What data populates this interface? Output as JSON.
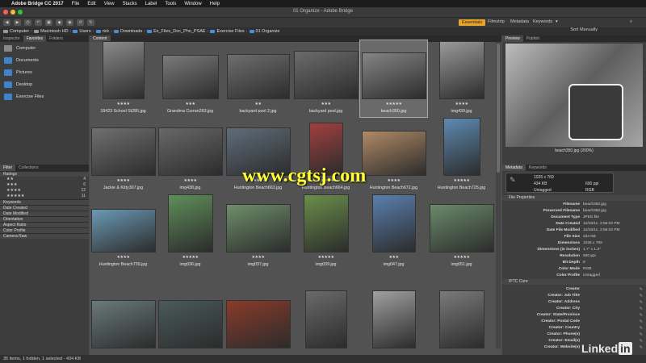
{
  "menubar": {
    "apple": "",
    "app": "Adobe Bridge CC 2017",
    "items": [
      "File",
      "Edit",
      "View",
      "Stacks",
      "Label",
      "Tools",
      "Window",
      "Help"
    ]
  },
  "window": {
    "title": "01 Organize - Adobe Bridge"
  },
  "workspaces": [
    "Essentials",
    "Filmstrip",
    "Metadata",
    "Keywords"
  ],
  "pathbar": {
    "crumbs": [
      "Computer",
      "Macintosh HD",
      "Users",
      "rick",
      "Downloads",
      "Ex_Files_Doc_Pho_PSAE",
      "Exercise Files",
      "01 Organize"
    ],
    "sort": "Sort Manually"
  },
  "leftpanel": {
    "tabs": [
      "Inspector",
      "Favorites",
      "Folders"
    ],
    "favorites": [
      {
        "label": "Computer",
        "icon": "computer-icon"
      },
      {
        "label": "Documents",
        "icon": "folder-icon"
      },
      {
        "label": "Pictures",
        "icon": "folder-icon"
      },
      {
        "label": "Desktop",
        "icon": "folder-icon"
      },
      {
        "label": "Exercise Files",
        "icon": "folder-icon"
      }
    ],
    "filter_tabs": [
      "Filter",
      "Collections"
    ],
    "ratings_header": "Ratings",
    "ratings": [
      {
        "stars": "★★",
        "count": "4"
      },
      {
        "stars": "★★★",
        "count": "6"
      },
      {
        "stars": "★★★★",
        "count": "12"
      },
      {
        "stars": "★★★★★",
        "count": "11"
      }
    ],
    "filter_sections": [
      "Keywords",
      "Date Created",
      "Date Modified",
      "Orientation",
      "Aspect Ratio",
      "Color Profile",
      "Camera Raw"
    ]
  },
  "content": {
    "tab": "Content",
    "thumbs": [
      {
        "name": "18423 School St285.jpg",
        "stars": "★★★★"
      },
      {
        "name": "Grandma Curran283.jpg",
        "stars": "★★★"
      },
      {
        "name": "backyard pool 2.jpg",
        "stars": "★★"
      },
      {
        "name": "backyard pool.jpg",
        "stars": "★★★"
      },
      {
        "name": "beach350.jpg",
        "stars": "★★★★★"
      },
      {
        "name": "img439.jpg",
        "stars": "★★★★"
      },
      {
        "name": "Jackie & Kitty307.jpg",
        "stars": "★★★★"
      },
      {
        "name": "img438.jpg",
        "stars": "★★★★"
      },
      {
        "name": "Huntington Beach663.jpg",
        "stars": "★★★★★"
      },
      {
        "name": "Huntington Beach664.jpg",
        "stars": "★★★★★"
      },
      {
        "name": "Huntington Beach672.jpg",
        "stars": "★★★★"
      },
      {
        "name": "Huntington Beach725.jpg",
        "stars": "★★★★★"
      },
      {
        "name": "Huntington Beach739.jpg",
        "stars": "★★★★"
      },
      {
        "name": "img036.jpg",
        "stars": "★★★★★"
      },
      {
        "name": "img037.jpg",
        "stars": "★★★★"
      },
      {
        "name": "img039.jpg",
        "stars": "★★★★★"
      },
      {
        "name": "img047.jpg",
        "stars": "★★★"
      },
      {
        "name": "img051.jpg",
        "stars": "★★★★★"
      },
      {
        "name": "",
        "stars": ""
      },
      {
        "name": "",
        "stars": ""
      },
      {
        "name": "",
        "stars": ""
      },
      {
        "name": "",
        "stars": ""
      },
      {
        "name": "",
        "stars": ""
      },
      {
        "name": "",
        "stars": ""
      }
    ]
  },
  "watermark": "www.cgtsj.com",
  "rightpanel": {
    "tabs": [
      "Preview",
      "Publish"
    ],
    "preview_caption": "beach350.jpg (200%)",
    "meta_tabs": [
      "Metadata",
      "Keywords"
    ],
    "quick": {
      "dims": "1026 x 769",
      "ppi": "600 ppi",
      "size": "434 KB",
      "mode": "RGB",
      "profile": "Untagged"
    },
    "file_props_header": "File Properties",
    "file_props": [
      {
        "k": "Filename",
        "v": "beach350.jpg"
      },
      {
        "k": "Preserved Filename",
        "v": "beach350.jpg"
      },
      {
        "k": "Document Type",
        "v": "JPEG file"
      },
      {
        "k": "Date Created",
        "v": "12/16/11, 2:56:02 PM"
      },
      {
        "k": "Date File Modified",
        "v": "12/16/11, 2:56:02 PM"
      },
      {
        "k": "File Size",
        "v": "434 KB"
      },
      {
        "k": "Dimensions",
        "v": "1026 x 769"
      },
      {
        "k": "Dimensions (in inches)",
        "v": "1.7\" x 1.3\""
      },
      {
        "k": "Resolution",
        "v": "600 ppi"
      },
      {
        "k": "Bit Depth",
        "v": "8"
      },
      {
        "k": "Color Mode",
        "v": "RGB"
      },
      {
        "k": "Color Profile",
        "v": "Untagged"
      }
    ],
    "iptc_header": "IPTC Core",
    "iptc": [
      "Creator",
      "Creator: Job Title",
      "Creator: Address",
      "Creator: City",
      "Creator: State/Province",
      "Creator: Postal Code",
      "Creator: Country",
      "Creator: Phone(s)",
      "Creator: Email(s)",
      "Creator: Website(s)"
    ]
  },
  "status": "35 items, 1 hidden, 1 selected - 434 KB",
  "branding": "Linked"
}
